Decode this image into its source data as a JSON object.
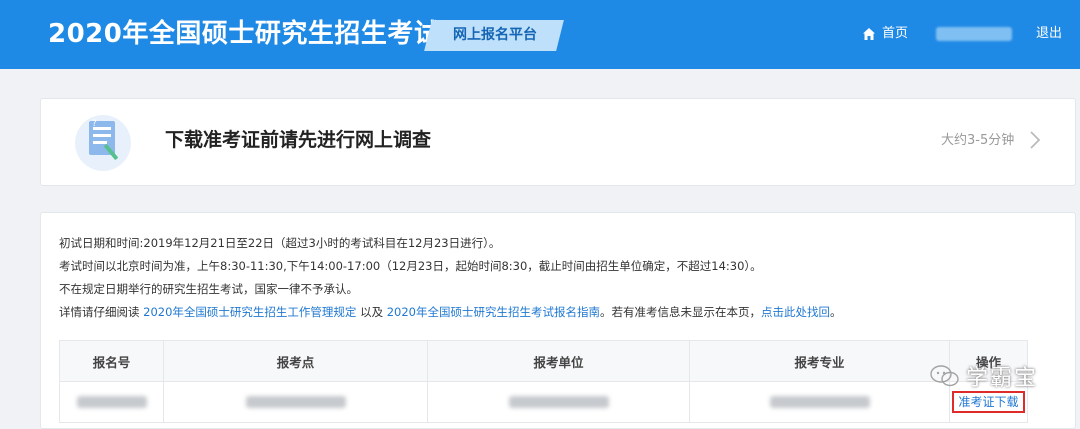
{
  "header": {
    "title": "2020年全国硕士研究生招生考试",
    "platform": "网上报名平台",
    "home_label": "首页",
    "logout_label": "退出",
    "brand_color": "#1f8ae6"
  },
  "survey": {
    "title": "下载准考证前请先进行网上调查",
    "time_hint": "大约3-5分钟",
    "icon": "questionnaire-icon",
    "arrow_icon": "chevron-right-icon"
  },
  "info": {
    "line1": "初试日期和时间:2019年12月21日至22日（超过3小时的考试科目在12月23日进行）。",
    "line2": "考试时间以北京时间为准，上午8:30-11:30,下午14:00-17:00（12月23日，起始时间8:30，截止时间由招生单位确定，不超过14:30）。",
    "line3": "不在规定日期举行的研究生招生考试，国家一律不予承认。",
    "line4_prefix": "详情请仔细阅读 ",
    "line4_link1": "2020年全国硕士研究生招生工作管理规定",
    "line4_mid": " 以及 ",
    "line4_link2": "2020年全国硕士研究生招生考试报名指南",
    "line4_mid2": "。若有准考信息未显示在本页，",
    "line4_link3": "点击此处找回",
    "line4_end": "。"
  },
  "table": {
    "headers": [
      "报名号",
      "报考点",
      "报考单位",
      "报考专业",
      "操作"
    ],
    "action_label": "准考证下载"
  },
  "watermark": {
    "text": "学霸宝"
  }
}
